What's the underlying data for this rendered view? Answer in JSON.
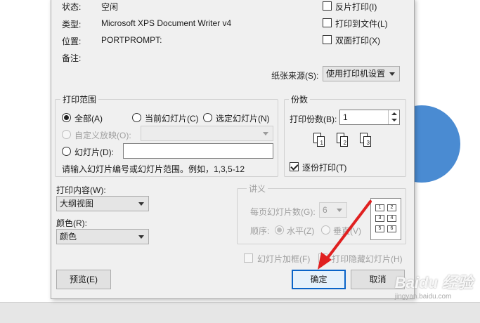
{
  "printer": {
    "status_label": "状态:",
    "status_value": "空闲",
    "type_label": "类型:",
    "type_value": "Microsoft XPS Document Writer v4",
    "location_label": "位置:",
    "location_value": "PORTPROMPT:",
    "comment_label": "备注:",
    "options": [
      {
        "label": "反片打印(I)",
        "checked": false
      },
      {
        "label": "打印到文件(L)",
        "checked": false
      },
      {
        "label": "双面打印(X)",
        "checked": false
      }
    ],
    "paper_source_label": "纸张来源(S):",
    "paper_source_value": "使用打印机设置"
  },
  "print_range": {
    "title": "打印范围",
    "all_label": "全部(A)",
    "current_label": "当前幻灯片(C)",
    "selection_label": "选定幻灯片(N)",
    "custom_label": "自定义放映(O):",
    "custom_value": "",
    "slides_label": "幻灯片(D):",
    "slides_value": "",
    "hint": "请输入幻灯片编号或幻灯片范围。例如，1,3,5-12"
  },
  "copies": {
    "title": "份数",
    "count_label": "打印份数(B):",
    "count_value": "1",
    "collate_label": "逐份打印(T)",
    "collate_checked": true,
    "collate_pages": [
      "1",
      "2",
      "3"
    ]
  },
  "print_what": {
    "label": "打印内容(W):",
    "value": "大纲视图"
  },
  "color": {
    "label": "颜色(R):",
    "value": "颜色"
  },
  "handouts": {
    "title": "讲义",
    "per_page_label": "每页幻灯片数(G):",
    "per_page_value": "6",
    "order_label": "顺序:",
    "horizontal_label": "水平(Z)",
    "vertical_label": "垂直(V)",
    "preview_cells": [
      "1",
      "2",
      "3",
      "4",
      "5",
      "6"
    ]
  },
  "frame_slides_label": "幻灯片加框(F)",
  "print_hidden_label": "打印隐藏幻灯片(H)",
  "buttons": {
    "preview": "预览(E)",
    "ok": "确定",
    "cancel": "取消"
  },
  "watermark": {
    "brand": "Baidu 经验",
    "url": "jingyan.baidu.com"
  },
  "colors": {
    "accent_blue": "#0a64c8",
    "arrow_red": "#e02020",
    "backdrop_circle": "#4a8bd2"
  }
}
